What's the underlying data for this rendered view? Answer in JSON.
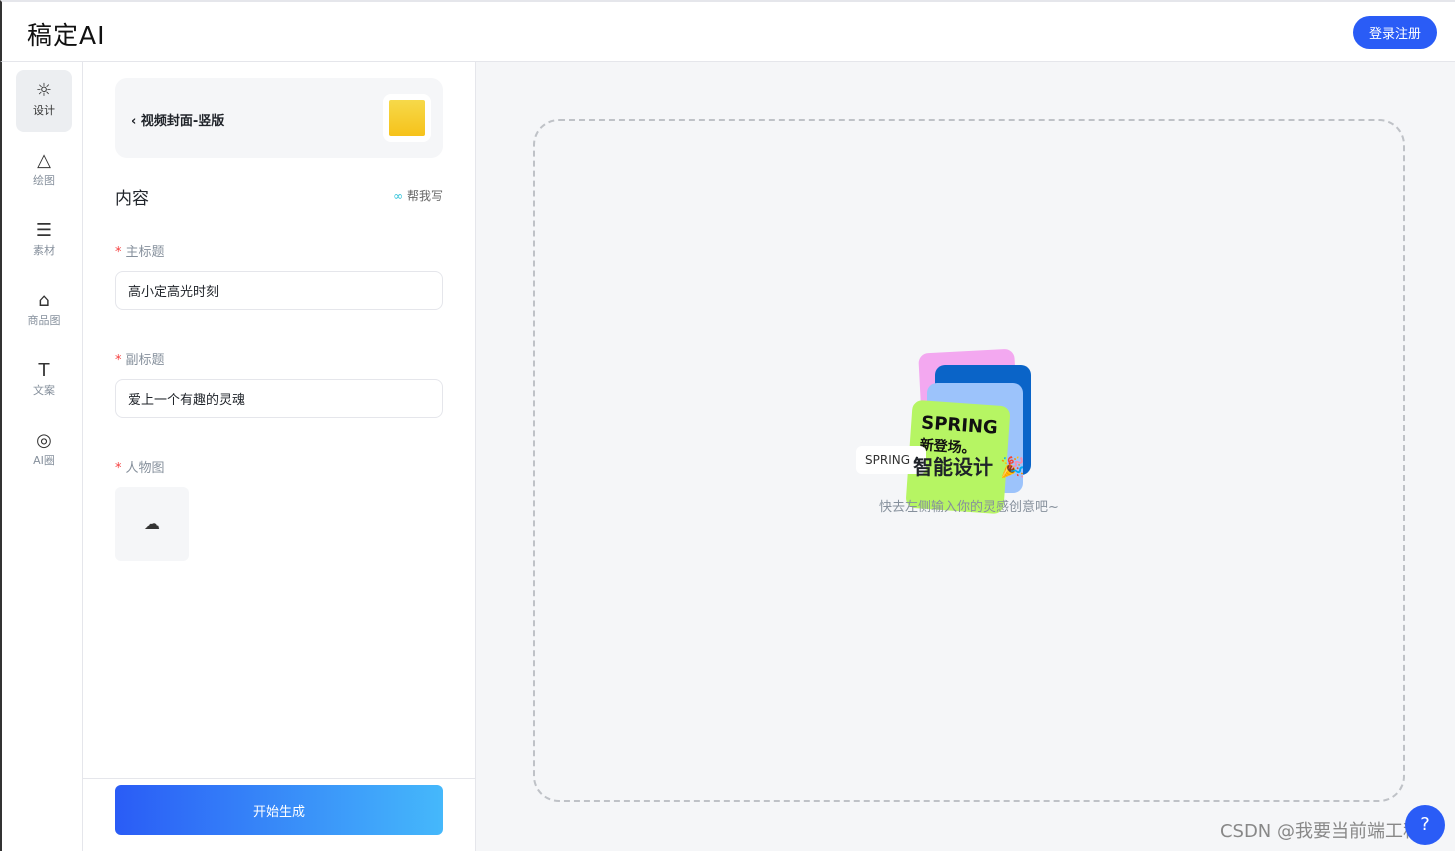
{
  "header": {
    "logo": "稿定AI",
    "login_label": "登录注册"
  },
  "sidebar": {
    "items": [
      {
        "label": "设计",
        "icon": "sunrise-icon",
        "glyph": "☀"
      },
      {
        "label": "绘图",
        "icon": "mountain-icon",
        "glyph": "⛰"
      },
      {
        "label": "素材",
        "icon": "list-diamond-icon",
        "glyph": "☰"
      },
      {
        "label": "商品图",
        "icon": "bag-icon",
        "glyph": "👜"
      },
      {
        "label": "文案",
        "icon": "text-icon",
        "glyph": "T"
      },
      {
        "label": "AI圈",
        "icon": "ai-circle-icon",
        "glyph": "◎"
      }
    ]
  },
  "panel": {
    "template_title": "视频封面-竖版",
    "section_title": "内容",
    "help_write": "帮我写",
    "fields": [
      {
        "label": "主标题",
        "value": "高小定高光时刻"
      },
      {
        "label": "副标题",
        "value": "爱上一个有趣的灵魂"
      },
      {
        "label": "人物图"
      }
    ],
    "generate_label": "开始生成"
  },
  "canvas": {
    "input_sample": "SPRING",
    "card_text": "SPRING",
    "card_subtext": "新登场。",
    "title": "智能设计",
    "emoji": "🎉",
    "subtitle": "快去左侧输入你的灵感创意吧~"
  },
  "watermark": "CSDN @我要当前端工程师",
  "help_button": "?"
}
